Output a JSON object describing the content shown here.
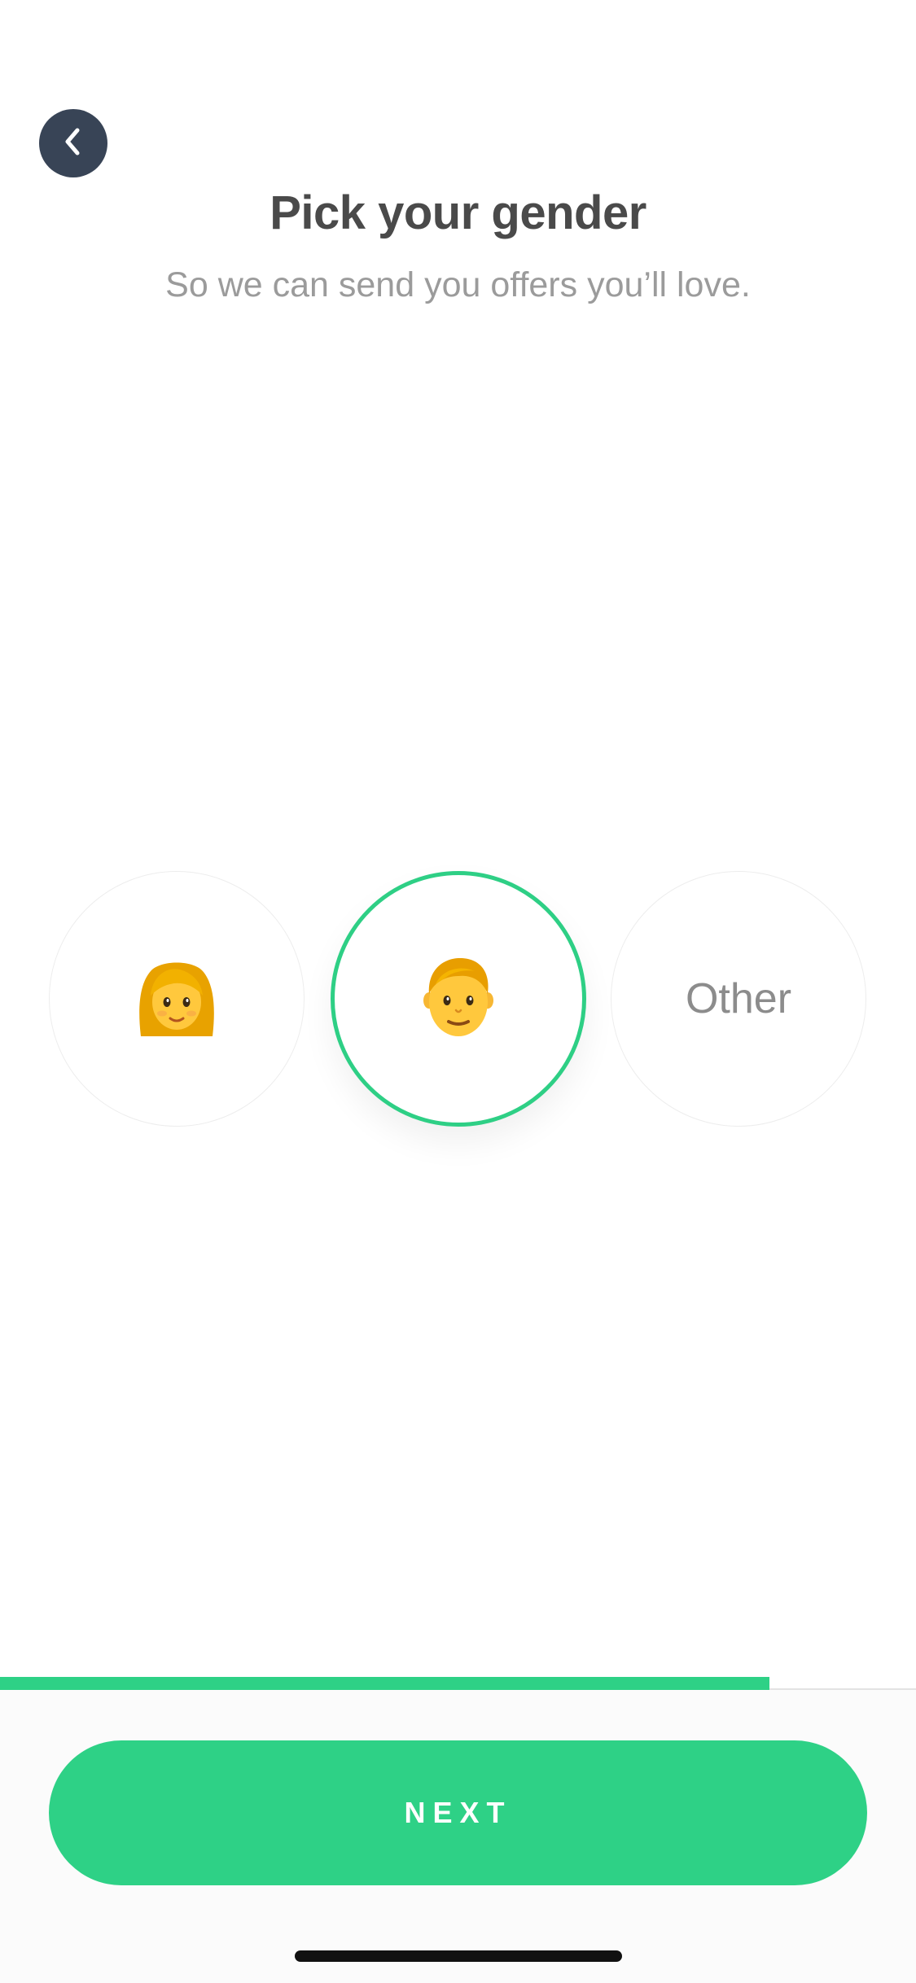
{
  "header": {
    "back_icon": "chevron-left-icon",
    "title": "Pick your gender",
    "subtitle": "So we can send you offers you’ll love."
  },
  "gender_options": [
    {
      "id": "female",
      "icon": "woman-emoji-icon",
      "selected": false
    },
    {
      "id": "male",
      "icon": "man-emoji-icon",
      "selected": true
    },
    {
      "id": "other",
      "label": "Other",
      "selected": false
    }
  ],
  "progress": {
    "fraction": 0.84
  },
  "footer": {
    "next_label": "NEXT"
  },
  "colors": {
    "accent": "#2ed186",
    "back_button": "#384456",
    "title": "#4a4a4a",
    "subtitle": "#9b9b9b"
  }
}
